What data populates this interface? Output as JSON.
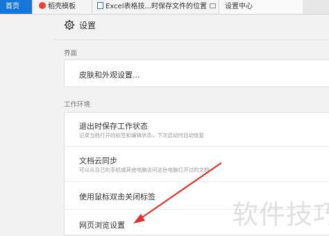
{
  "tabs": [
    {
      "label": "首页"
    },
    {
      "label": "稻壳模板"
    },
    {
      "label": "Excel表格技...时保存文件的位置"
    },
    {
      "label": "设置中心"
    }
  ],
  "tab_close_glyph": "×",
  "page": {
    "title": "设置"
  },
  "sections": {
    "interface": {
      "label": "界面",
      "items": [
        {
          "title": "皮肤和外观设置..."
        }
      ]
    },
    "work_env": {
      "label": "工作环境",
      "items": [
        {
          "title": "退出时保存工作状态",
          "desc": "记录当前打开的标签和编辑状态，下次启动时自动恢复"
        },
        {
          "title": "文档云同步",
          "desc": "可以从自己的手机或其他电脑访问这台电脑打开过的文档"
        },
        {
          "title": "使用鼠标双击关闭标签"
        },
        {
          "title": "网页浏览设置"
        }
      ]
    }
  },
  "watermark": "软件技巧",
  "colors": {
    "active_tab": "#1677d9",
    "arrow": "#e0322e",
    "daoke_icon": "#e8452c"
  }
}
